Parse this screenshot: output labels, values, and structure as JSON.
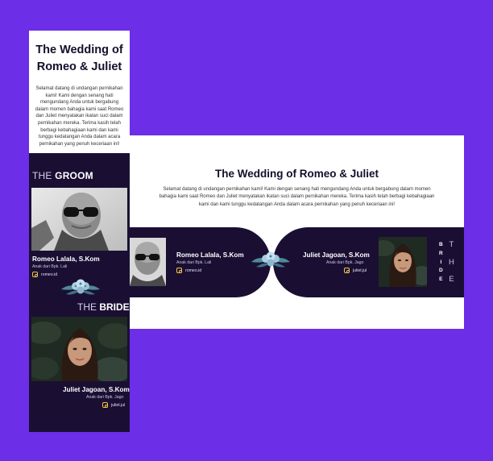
{
  "mobile": {
    "title_line1": "The Wedding of",
    "title_line2": "Romeo & Juliet",
    "intro_text": "Selamat datang di undangan pernikahan kami! Kami dengan senang hati mengundang Anda untuk bergabung dalam momen bahagia kami saat Romeo dan Juliet menyatakan ikatan suci dalam pernikahan mereka. Terima kasih telah berbagi kebahagiaan kami dan kami tunggu kedatangan Anda dalam acara pernikahan yang penuh keceriaan ini!",
    "groom_heading_thin": "THE",
    "groom_heading_bold": "GROOM",
    "bride_heading_thin": "THE",
    "bride_heading_bold": "BRIDE"
  },
  "desktop": {
    "title": "The Wedding of Romeo & Juliet",
    "intro_text": "Selamat datang di undangan pernikahan kami! Kami dengan senang hati mengundang Anda untuk bergabung dalam momen bahagia kami saat Romeo dan Juliet menyatakan ikatan suci dalam pernikahan mereka. Terima kasih telah berbagi kebahagiaan kami dan kami tunggu kedatangan Anda dalam acara pernikahan yang penuh keceriaan ini!",
    "vertical_bride": [
      "B",
      "R",
      "I",
      "D",
      "E"
    ],
    "vertical_the": [
      "T",
      "H",
      "E"
    ]
  },
  "groom": {
    "name": "Romeo Lalala, S.Kom",
    "parents": "Anak dari Bpk. Lali",
    "instagram": "romeo.id"
  },
  "bride": {
    "name": "Juliet Jagoan, S.Kom",
    "parents": "Anak dari Bpk. Jago",
    "instagram": "juliet.jul"
  },
  "icons": {
    "instagram": "instagram-icon",
    "flower": "flower-bouquet-icon"
  },
  "colors": {
    "background": "#6c2ee6",
    "card": "#ffffff",
    "dark_panel": "#1a0f33",
    "accent_icon": "#f0c548"
  }
}
